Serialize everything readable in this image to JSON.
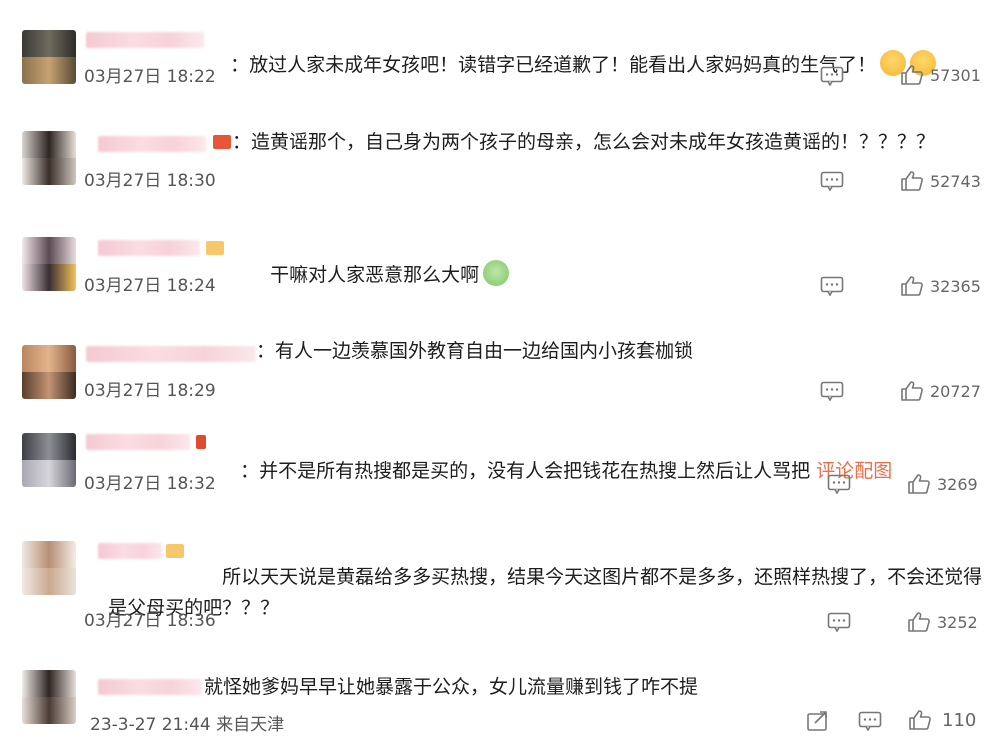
{
  "comments": [
    {
      "text": "：放过人家未成年女孩吧！读错字已经道歉了！能看出人家妈妈真的生气了！",
      "date": "03月27日 18:22",
      "likes": "57301"
    },
    {
      "text": "：造黄谣那个，自己身为两个孩子的母亲，怎么会对未成年女孩造黄谣的！？？？？",
      "date": "03月27日 18:30",
      "likes": "52743"
    },
    {
      "text": "干嘛对人家恶意那么大啊",
      "date": "03月27日 18:24",
      "likes": "32365"
    },
    {
      "text": "：有人一边羡慕国外教育自由一边给国内小孩套枷锁",
      "date": "03月27日 18:29",
      "likes": "20727"
    },
    {
      "text": "：并不是所有热搜都是买的，没有人会把钱花在热搜上然后让人骂把",
      "link": "评论配图",
      "date": "03月27日 18:32",
      "likes": "3269"
    },
    {
      "text_line1": "所以天天说是黄磊给多多买热搜，结果今天这图片都不是多多，还照样热搜了，不会还觉得",
      "text_line2": "是父母买的吧？？？",
      "date": "03月27日 18:36",
      "likes": "3252"
    },
    {
      "text": "就怪她爹妈早早让她暴露于公众，女儿流量赚到钱了咋不提",
      "date": "23-3-27 21:44 来自天津",
      "likes": "110"
    }
  ],
  "icons": {
    "comment": "comment-icon",
    "like": "thumbs-up-icon",
    "share": "share-icon"
  }
}
